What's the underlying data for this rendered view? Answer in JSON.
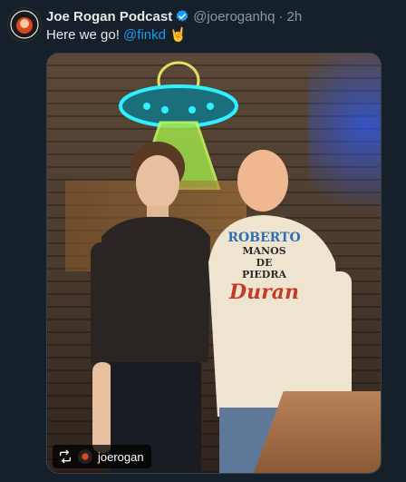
{
  "tweet": {
    "author_name": "Joe Rogan Podcast",
    "author_handle": "@joeroganhq",
    "separator": "·",
    "time": "2h",
    "text_prefix": "Here we go! ",
    "mention": "@finkd",
    "emoji": "🤘"
  },
  "media": {
    "credit_username": "joerogan"
  },
  "hoodie": {
    "line1": "ROBERTO",
    "line2": "MANOS",
    "line3": "DE",
    "line4": "PIEDRA",
    "line5": "Duran"
  },
  "colors": {
    "background": "#15202b",
    "accent": "#1d9bf0",
    "muted": "#8b98a5"
  },
  "icons": [
    "avatar",
    "verified-badge-icon",
    "retweet-icon"
  ]
}
